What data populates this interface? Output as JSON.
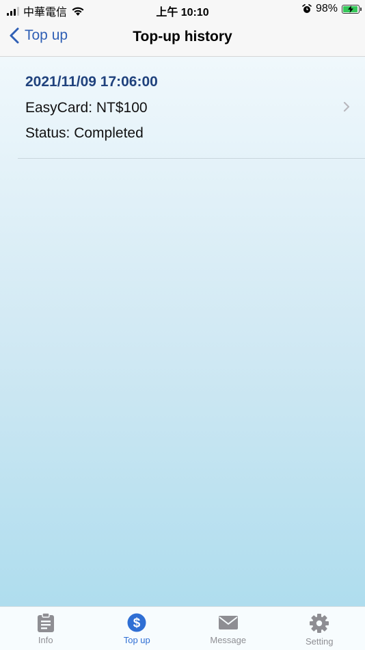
{
  "status_bar": {
    "carrier": "中華電信",
    "time": "上午 10:10",
    "battery_percent": "98%",
    "battery_level": 0.98
  },
  "nav": {
    "back_label": "Top up",
    "title": "Top-up history"
  },
  "history": [
    {
      "datetime": "2021/11/09 17:06:00",
      "amount": "EasyCard: NT$100",
      "status": "Status: Completed"
    }
  ],
  "tabs": [
    {
      "label": "Info",
      "icon": "clipboard-icon",
      "active": false
    },
    {
      "label": "Top up",
      "icon": "dollar-icon",
      "active": true
    },
    {
      "label": "Message",
      "icon": "envelope-icon",
      "active": false
    },
    {
      "label": "Setting",
      "icon": "gear-icon",
      "active": false
    }
  ],
  "colors": {
    "accent": "#2f6fd4",
    "date_text": "#20427d",
    "inactive_tab": "#8e8e93"
  }
}
